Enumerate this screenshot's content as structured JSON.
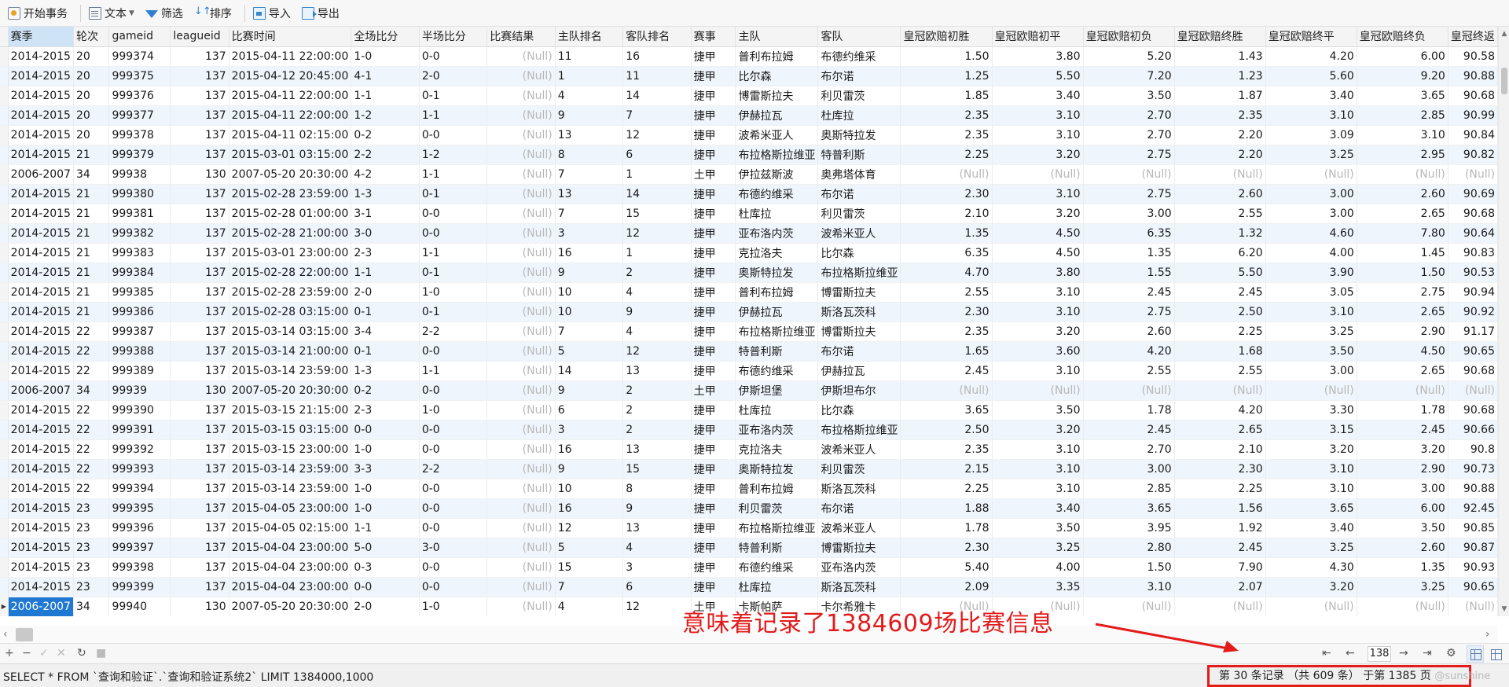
{
  "toolbar": {
    "begin_txn": "开始事务",
    "text": "文本",
    "filter": "筛选",
    "sort": "排序",
    "import": "导入",
    "export": "导出"
  },
  "columns": [
    "赛季",
    "轮次",
    "gameid",
    "leagueid",
    "比赛时间",
    "全场比分",
    "半场比分",
    "比赛结果",
    "主队排名",
    "客队排名",
    "赛事",
    "主队",
    "客队",
    "皇冠欧赔初胜",
    "皇冠欧赔初平",
    "皇冠欧赔初负",
    "皇冠欧赔终胜",
    "皇冠欧赔终平",
    "皇冠欧赔终负",
    "皇冠终返"
  ],
  "rows": [
    [
      "2014-2015",
      "20",
      "999374",
      "137",
      "2015-04-11 22:00:00",
      "1-0",
      "0-0",
      "(Null)",
      "11",
      "16",
      "捷甲",
      "普利布拉姆",
      "布德约维采",
      "1.50",
      "3.80",
      "5.20",
      "1.43",
      "4.20",
      "6.00",
      "90.58"
    ],
    [
      "2014-2015",
      "20",
      "999375",
      "137",
      "2015-04-12 20:45:00",
      "4-1",
      "2-0",
      "(Null)",
      "1",
      "11",
      "捷甲",
      "比尔森",
      "布尔诺",
      "1.25",
      "5.50",
      "7.20",
      "1.23",
      "5.60",
      "9.20",
      "90.88"
    ],
    [
      "2014-2015",
      "20",
      "999376",
      "137",
      "2015-04-11 22:00:00",
      "1-1",
      "0-1",
      "(Null)",
      "4",
      "14",
      "捷甲",
      "博雷斯拉夫",
      "利贝雷茨",
      "1.85",
      "3.40",
      "3.50",
      "1.87",
      "3.40",
      "3.65",
      "90.68"
    ],
    [
      "2014-2015",
      "20",
      "999377",
      "137",
      "2015-04-11 22:00:00",
      "1-2",
      "1-1",
      "(Null)",
      "9",
      "7",
      "捷甲",
      "伊赫拉瓦",
      "杜库拉",
      "2.35",
      "3.10",
      "2.70",
      "2.35",
      "3.10",
      "2.85",
      "90.99"
    ],
    [
      "2014-2015",
      "20",
      "999378",
      "137",
      "2015-04-11 02:15:00",
      "0-2",
      "0-0",
      "(Null)",
      "13",
      "12",
      "捷甲",
      "波希米亚人",
      "奥斯特拉发",
      "2.35",
      "3.10",
      "2.70",
      "2.20",
      "3.09",
      "3.10",
      "90.84"
    ],
    [
      "2014-2015",
      "21",
      "999379",
      "137",
      "2015-03-01 03:15:00",
      "2-2",
      "1-2",
      "(Null)",
      "8",
      "6",
      "捷甲",
      "布拉格斯拉维亚",
      "特普利斯",
      "2.25",
      "3.20",
      "2.75",
      "2.20",
      "3.25",
      "2.95",
      "90.82"
    ],
    [
      "2006-2007",
      "34",
      "99938",
      "130",
      "2007-05-20 20:30:00",
      "4-2",
      "1-1",
      "(Null)",
      "7",
      "1",
      "土甲",
      "伊拉兹斯波",
      "奥弗塔体育",
      "(Null)",
      "(Null)",
      "(Null)",
      "(Null)",
      "(Null)",
      "(Null)",
      "(Null)"
    ],
    [
      "2014-2015",
      "21",
      "999380",
      "137",
      "2015-02-28 23:59:00",
      "1-3",
      "0-1",
      "(Null)",
      "13",
      "14",
      "捷甲",
      "布德约维采",
      "布尔诺",
      "2.30",
      "3.10",
      "2.75",
      "2.60",
      "3.00",
      "2.60",
      "90.69"
    ],
    [
      "2014-2015",
      "21",
      "999381",
      "137",
      "2015-02-28 01:00:00",
      "3-1",
      "0-0",
      "(Null)",
      "7",
      "15",
      "捷甲",
      "杜库拉",
      "利贝雷茨",
      "2.10",
      "3.20",
      "3.00",
      "2.55",
      "3.00",
      "2.65",
      "90.68"
    ],
    [
      "2014-2015",
      "21",
      "999382",
      "137",
      "2015-02-28 21:00:00",
      "3-0",
      "0-0",
      "(Null)",
      "3",
      "12",
      "捷甲",
      "亚布洛内茨",
      "波希米亚人",
      "1.35",
      "4.50",
      "6.35",
      "1.32",
      "4.60",
      "7.80",
      "90.64"
    ],
    [
      "2014-2015",
      "21",
      "999383",
      "137",
      "2015-03-01 23:00:00",
      "2-3",
      "1-1",
      "(Null)",
      "16",
      "1",
      "捷甲",
      "克拉洛夫",
      "比尔森",
      "6.35",
      "4.50",
      "1.35",
      "6.20",
      "4.00",
      "1.45",
      "90.83"
    ],
    [
      "2014-2015",
      "21",
      "999384",
      "137",
      "2015-02-28 22:00:00",
      "1-1",
      "0-1",
      "(Null)",
      "9",
      "2",
      "捷甲",
      "奥斯特拉发",
      "布拉格斯拉维亚",
      "4.70",
      "3.80",
      "1.55",
      "5.50",
      "3.90",
      "1.50",
      "90.53"
    ],
    [
      "2014-2015",
      "21",
      "999385",
      "137",
      "2015-02-28 23:59:00",
      "2-0",
      "1-0",
      "(Null)",
      "10",
      "4",
      "捷甲",
      "普利布拉姆",
      "博雷斯拉夫",
      "2.55",
      "3.10",
      "2.45",
      "2.45",
      "3.05",
      "2.75",
      "90.94"
    ],
    [
      "2014-2015",
      "21",
      "999386",
      "137",
      "2015-02-28 03:15:00",
      "0-1",
      "0-1",
      "(Null)",
      "10",
      "9",
      "捷甲",
      "伊赫拉瓦",
      "斯洛瓦茨科",
      "2.30",
      "3.10",
      "2.75",
      "2.50",
      "3.10",
      "2.65",
      "90.92"
    ],
    [
      "2014-2015",
      "22",
      "999387",
      "137",
      "2015-03-14 03:15:00",
      "3-4",
      "2-2",
      "(Null)",
      "7",
      "4",
      "捷甲",
      "布拉格斯拉维亚",
      "博雷斯拉夫",
      "2.35",
      "3.20",
      "2.60",
      "2.25",
      "3.25",
      "2.90",
      "91.17"
    ],
    [
      "2014-2015",
      "22",
      "999388",
      "137",
      "2015-03-14 21:00:00",
      "0-1",
      "0-0",
      "(Null)",
      "5",
      "12",
      "捷甲",
      "特普利斯",
      "布尔诺",
      "1.65",
      "3.60",
      "4.20",
      "1.68",
      "3.50",
      "4.50",
      "90.65"
    ],
    [
      "2014-2015",
      "22",
      "999389",
      "137",
      "2015-03-14 23:59:00",
      "1-3",
      "1-1",
      "(Null)",
      "14",
      "13",
      "捷甲",
      "布德约维采",
      "伊赫拉瓦",
      "2.45",
      "3.10",
      "2.55",
      "2.55",
      "3.00",
      "2.65",
      "90.68"
    ],
    [
      "2006-2007",
      "34",
      "99939",
      "130",
      "2007-05-20 20:30:00",
      "0-2",
      "0-0",
      "(Null)",
      "9",
      "2",
      "土甲",
      "伊斯坦堡",
      "伊斯坦布尔",
      "(Null)",
      "(Null)",
      "(Null)",
      "(Null)",
      "(Null)",
      "(Null)",
      "(Null)"
    ],
    [
      "2014-2015",
      "22",
      "999390",
      "137",
      "2015-03-15 21:15:00",
      "2-3",
      "1-0",
      "(Null)",
      "6",
      "2",
      "捷甲",
      "杜库拉",
      "比尔森",
      "3.65",
      "3.50",
      "1.78",
      "4.20",
      "3.30",
      "1.78",
      "90.68"
    ],
    [
      "2014-2015",
      "22",
      "999391",
      "137",
      "2015-03-15 03:15:00",
      "0-0",
      "0-0",
      "(Null)",
      "3",
      "2",
      "捷甲",
      "亚布洛内茨",
      "布拉格斯拉维亚",
      "2.50",
      "3.20",
      "2.45",
      "2.65",
      "3.15",
      "2.45",
      "90.66"
    ],
    [
      "2014-2015",
      "22",
      "999392",
      "137",
      "2015-03-15 23:00:00",
      "1-0",
      "0-0",
      "(Null)",
      "16",
      "13",
      "捷甲",
      "克拉洛夫",
      "波希米亚人",
      "2.35",
      "3.10",
      "2.70",
      "2.10",
      "3.20",
      "3.20",
      "90.8"
    ],
    [
      "2014-2015",
      "22",
      "999393",
      "137",
      "2015-03-14 23:59:00",
      "3-3",
      "2-2",
      "(Null)",
      "9",
      "15",
      "捷甲",
      "奥斯特拉发",
      "利贝雷茨",
      "2.15",
      "3.10",
      "3.00",
      "2.30",
      "3.10",
      "2.90",
      "90.73"
    ],
    [
      "2014-2015",
      "22",
      "999394",
      "137",
      "2015-03-14 23:59:00",
      "1-0",
      "0-0",
      "(Null)",
      "10",
      "8",
      "捷甲",
      "普利布拉姆",
      "斯洛瓦茨科",
      "2.25",
      "3.10",
      "2.85",
      "2.25",
      "3.10",
      "3.00",
      "90.88"
    ],
    [
      "2014-2015",
      "23",
      "999395",
      "137",
      "2015-04-05 23:00:00",
      "1-0",
      "0-0",
      "(Null)",
      "16",
      "9",
      "捷甲",
      "利贝雷茨",
      "布尔诺",
      "1.88",
      "3.40",
      "3.65",
      "1.56",
      "3.65",
      "6.00",
      "92.45"
    ],
    [
      "2014-2015",
      "23",
      "999396",
      "137",
      "2015-04-05 02:15:00",
      "1-1",
      "0-0",
      "(Null)",
      "12",
      "13",
      "捷甲",
      "布拉格斯拉维亚",
      "波希米亚人",
      "1.78",
      "3.50",
      "3.95",
      "1.92",
      "3.40",
      "3.50",
      "90.85"
    ],
    [
      "2014-2015",
      "23",
      "999397",
      "137",
      "2015-04-04 23:00:00",
      "5-0",
      "3-0",
      "(Null)",
      "5",
      "4",
      "捷甲",
      "特普利斯",
      "博雷斯拉夫",
      "2.30",
      "3.25",
      "2.80",
      "2.45",
      "3.25",
      "2.60",
      "90.87"
    ],
    [
      "2014-2015",
      "23",
      "999398",
      "137",
      "2015-04-04 23:00:00",
      "0-3",
      "0-0",
      "(Null)",
      "15",
      "3",
      "捷甲",
      "布德约维采",
      "亚布洛内茨",
      "5.40",
      "4.00",
      "1.50",
      "7.90",
      "4.30",
      "1.35",
      "90.93"
    ],
    [
      "2014-2015",
      "23",
      "999399",
      "137",
      "2015-04-04 23:00:00",
      "0-0",
      "0-0",
      "(Null)",
      "7",
      "6",
      "捷甲",
      "杜库拉",
      "斯洛瓦茨科",
      "2.09",
      "3.35",
      "3.10",
      "2.07",
      "3.20",
      "3.25",
      "90.65"
    ],
    [
      "2006-2007",
      "34",
      "99940",
      "130",
      "2007-05-20 20:30:00",
      "2-0",
      "1-0",
      "(Null)",
      "4",
      "12",
      "土甲",
      "卡斯帕萨",
      "卡尔希雅卡",
      "(Null)",
      "(Null)",
      "(Null)",
      "(Null)",
      "(Null)",
      "(Null)",
      "(Null)"
    ]
  ],
  "pager": {
    "page": "138"
  },
  "status": {
    "sql": "SELECT * FROM `查询和验证`.`查询和验证系统2` LIMIT 1384000,1000",
    "record_info": "第 30 条记录 （共 609 条） 于第 1385 页",
    "watermark": "@sunshine"
  },
  "annotation": {
    "text": "意味着记录了1384609场比赛信息",
    "color": "#e31b1b"
  },
  "colors": {
    "selection": "#1f78d1",
    "alt_row": "#eef5fc",
    "null_text": "#b8b8b8",
    "annotation_red": "#e31b1b"
  }
}
